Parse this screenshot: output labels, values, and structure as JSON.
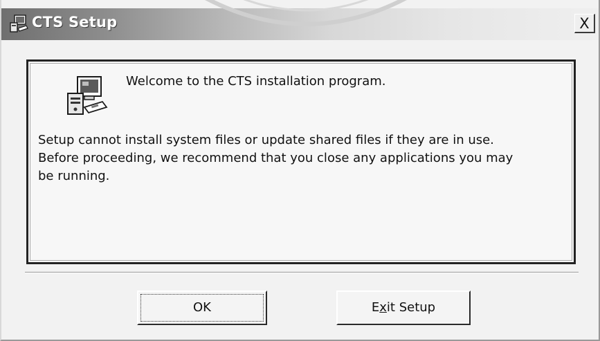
{
  "window": {
    "title": "CTS Setup",
    "close_glyph": "X",
    "title_icon": "setup-computer-icon",
    "close_icon": "close-icon"
  },
  "panel": {
    "icon": "setup-computer-icon",
    "welcome": "Welcome to the CTS installation program.",
    "body_lines": [
      "Setup cannot install system files or update shared files if they are in use.",
      "Before proceeding, we recommend that you close any applications you may",
      "be running."
    ]
  },
  "buttons": {
    "ok_label": "OK",
    "exit_label_before": "E",
    "exit_label_accel": "x",
    "exit_label_after": "it Setup"
  }
}
